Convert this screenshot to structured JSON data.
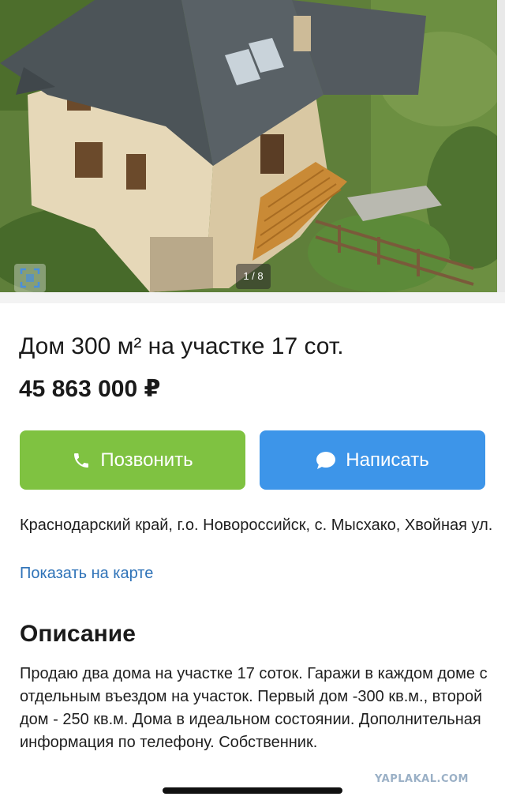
{
  "gallery": {
    "counter": "1 / 8",
    "fullscreen_icon": "fullscreen-icon"
  },
  "listing": {
    "title": "Дом 300 м² на участке 17 сот.",
    "price": "45 863 000 ₽"
  },
  "actions": {
    "call_label": "Позвонить",
    "call_icon": "phone-icon",
    "message_label": "Написать",
    "message_icon": "chat-bubble-icon",
    "call_color": "#7fc241",
    "message_color": "#3d95e9"
  },
  "location": {
    "address": "Краснодарский край, г.о. Новороссийск, с. Мысхако, Хвойная ул.",
    "map_link": "Показать на карте"
  },
  "description": {
    "heading": "Описание",
    "text": "Продаю два дома на участке 17 соток. Гаражи в каждом доме с отдельным въездом на участок. Первый дом -300 кв.м., второй дом - 250 кв.м. Дома в идеальном состоянии. Дополнительная информация по телефону. Собственник."
  },
  "watermark": "YAPLAKAL.COM"
}
